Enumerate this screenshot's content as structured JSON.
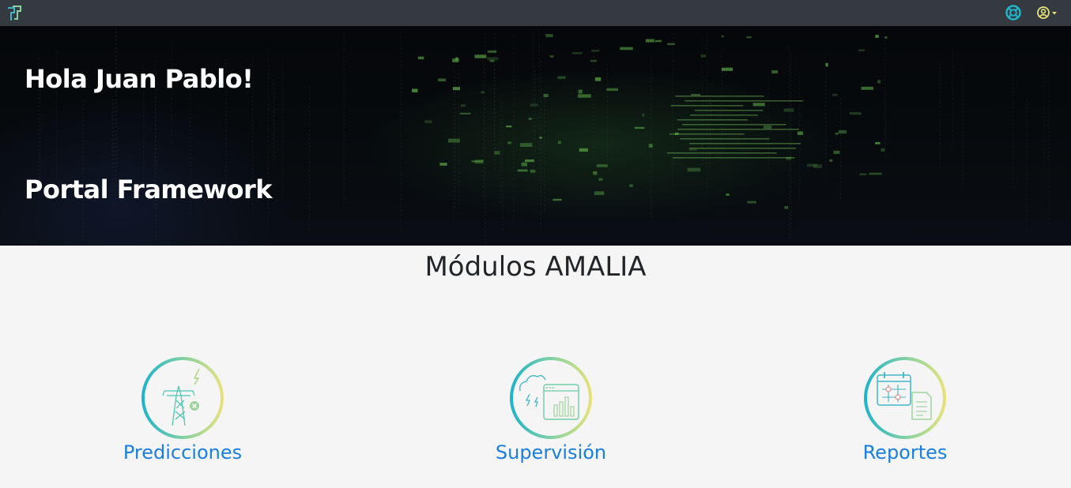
{
  "navbar": {
    "logo_icon": "portal-logo-icon",
    "help_icon": "lifebuoy-icon",
    "user_icon": "user-circle-icon"
  },
  "hero": {
    "greeting": "Hola Juan Pablo!",
    "subtitle": "Portal Framework"
  },
  "main": {
    "title": "Módulos AMALIA",
    "modules": [
      {
        "label": "Predicciones",
        "icon": "power-tower-icon"
      },
      {
        "label": "Supervisión",
        "icon": "monitoring-dashboard-icon"
      },
      {
        "label": "Reportes",
        "icon": "calendar-report-icon"
      }
    ]
  },
  "colors": {
    "navbar_bg": "#343a40",
    "link": "#1a7fe0",
    "accent_teal": "#1fb5c9",
    "accent_yellow": "#e6e27a",
    "page_bg": "#f4f5f4"
  }
}
